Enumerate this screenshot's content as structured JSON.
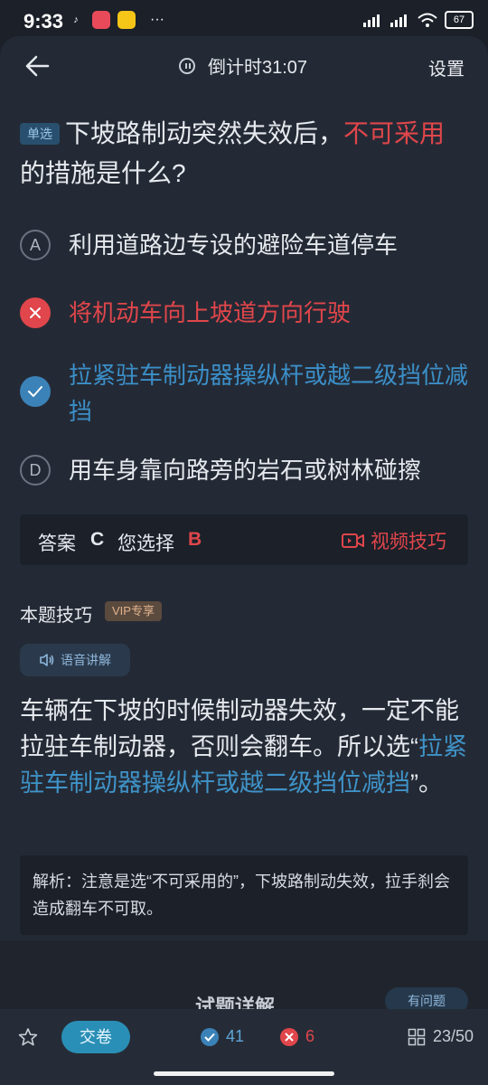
{
  "status_bar": {
    "time": "9:33",
    "battery": "67",
    "apps": [
      "tiktok-icon",
      "app-icon",
      "meituan-icon",
      "more-icon"
    ],
    "more": "···"
  },
  "nav": {
    "timer_label": "倒计时31:07",
    "settings": "设置"
  },
  "question": {
    "tag": "单选",
    "text_before": "下坡路制动突然失效后，",
    "text_highlight": "不可采用",
    "text_after": "的措施是什么?"
  },
  "options": [
    {
      "letter": "A",
      "text": "利用道路边专设的避险车道停车",
      "state": "normal"
    },
    {
      "letter": "B",
      "text": "将机动车向上坡道方向行驶",
      "state": "wrong"
    },
    {
      "letter": "C",
      "text": "拉紧驻车制动器操纵杆或越二级挡位减挡",
      "state": "correct"
    },
    {
      "letter": "D",
      "text": "用车身靠向路旁的岩石或树林碰擦",
      "state": "normal"
    }
  ],
  "answer": {
    "label": "答案",
    "value": "C",
    "selected_label": "您选择",
    "selected_value": "B",
    "video_tip": "视频技巧"
  },
  "tips": {
    "title": "本题技巧",
    "vip": "VIP专享",
    "voice": "语音讲解",
    "text_before": "车辆在下坡的时候制动器失效，一定不能拉驻车制动器，否则会翻车。所以选“",
    "text_highlight": "拉紧驻车制动器操纵杆或越二级挡位减挡",
    "text_after": "”。"
  },
  "analysis": {
    "text": "解析：注意是选“不可采用的”，下坡路制动失效，拉手刹会造成翻车不可取。"
  },
  "detail": {
    "title": "试题详解",
    "button": "有问题"
  },
  "bottom": {
    "submit": "交卷",
    "correct_count": "41",
    "wrong_count": "6",
    "progress": "23/50"
  },
  "colors": {
    "wrong": "#e0464b",
    "correct": "#3b82b8",
    "background": "#242a35"
  }
}
